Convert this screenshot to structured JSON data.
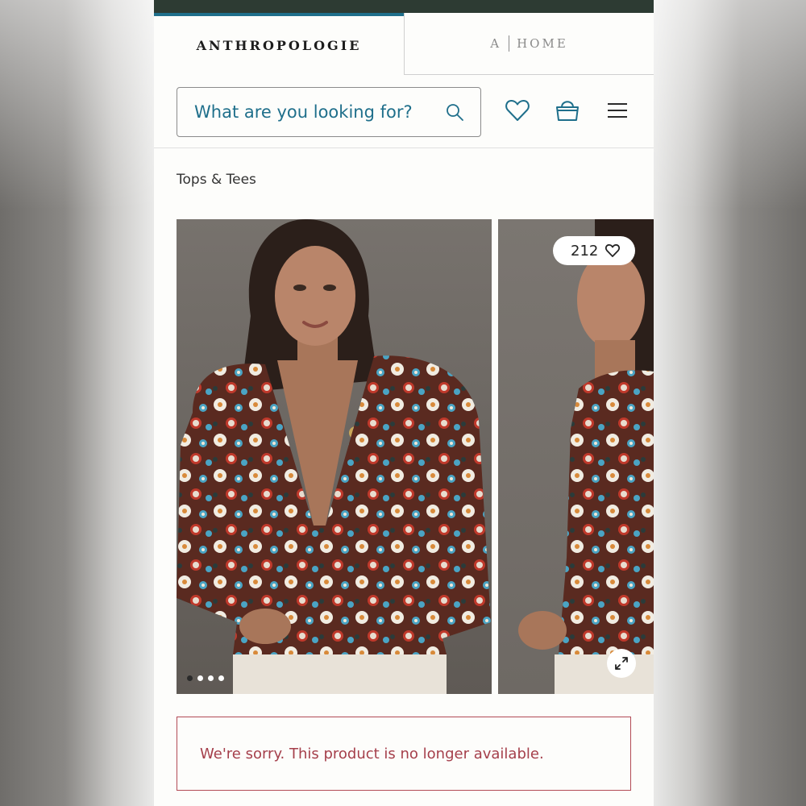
{
  "tabs": [
    {
      "label": "ANTHROPOLOGIE",
      "active": true
    },
    {
      "label_a": "A",
      "label_home": "HOME",
      "active": false
    }
  ],
  "search": {
    "placeholder": "What are you looking for?"
  },
  "header_icons": [
    "heart-icon",
    "basket-icon",
    "hamburger-menu-icon"
  ],
  "breadcrumb": "Tops & Tees",
  "gallery": {
    "likes_count": "212",
    "carousel_dots": 4,
    "active_dot": 0
  },
  "notice": {
    "text": "We're sorry. This product is no longer available."
  },
  "colors": {
    "accent": "#1f6f8b",
    "top_strip": "#2d3b33",
    "error": "#a53f4b"
  }
}
